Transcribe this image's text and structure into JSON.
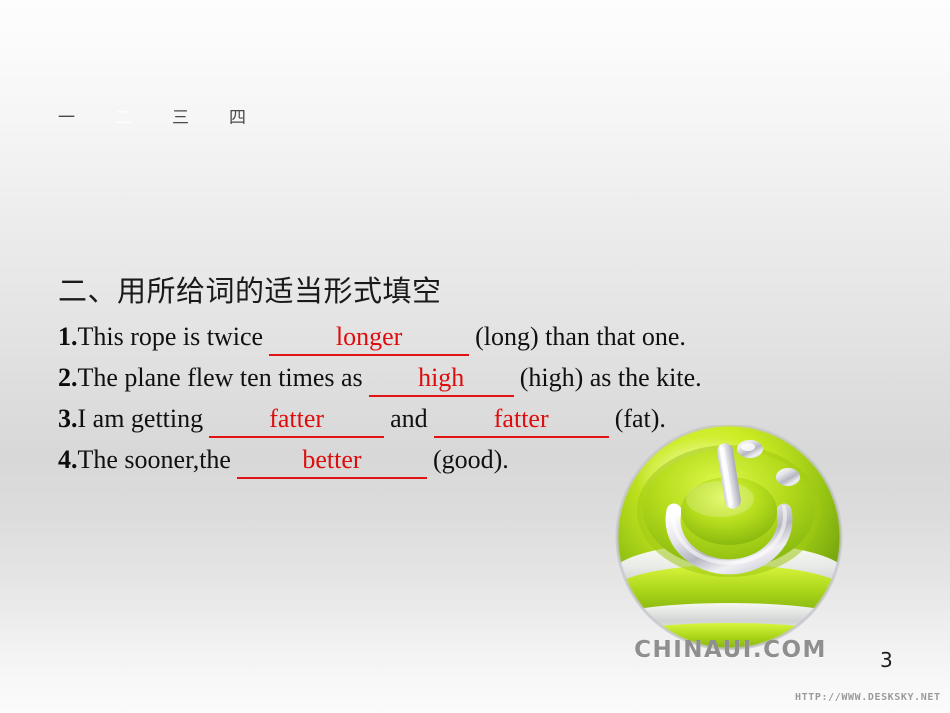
{
  "slide": {
    "page_number": "3",
    "background_top_color": "#fdfdfd",
    "background_mid_color": "#d8d8d8",
    "background_bottom_color": "#fbfbfb",
    "answer_color": "#dd0d0d",
    "text_color": "#101010"
  },
  "tabs": [
    {
      "label": "一",
      "active": false
    },
    {
      "label": "二",
      "active": true
    },
    {
      "label": "三",
      "active": false
    },
    {
      "label": "四",
      "active": false
    }
  ],
  "heading": "二、用所给词的适当形式填空",
  "questions": [
    {
      "number": "1.",
      "before": "This rope is twice",
      "answer": "longer",
      "after": "(long) than that one."
    },
    {
      "number": "2.",
      "before": "The plane flew ten times as",
      "answer": "high",
      "after": "(high) as the kite."
    },
    {
      "number": "3.",
      "before": "I am getting",
      "answer": "fatter",
      "middle": "and",
      "answer2": "fatter",
      "after": "(fat)."
    },
    {
      "number": "4.",
      "before": "The sooner,the",
      "answer": "better",
      "after": "(good)."
    }
  ],
  "branding": {
    "wordmark": "CHINAUI.COM",
    "logo_icon": "power-button-sphere-logo",
    "logo_green_light": "#d4f02a",
    "logo_green_dark": "#6f9c10",
    "logo_silver": "#e8e8ec"
  },
  "watermark": {
    "url": "HTTP://WWW.DESKSKY.NET"
  }
}
